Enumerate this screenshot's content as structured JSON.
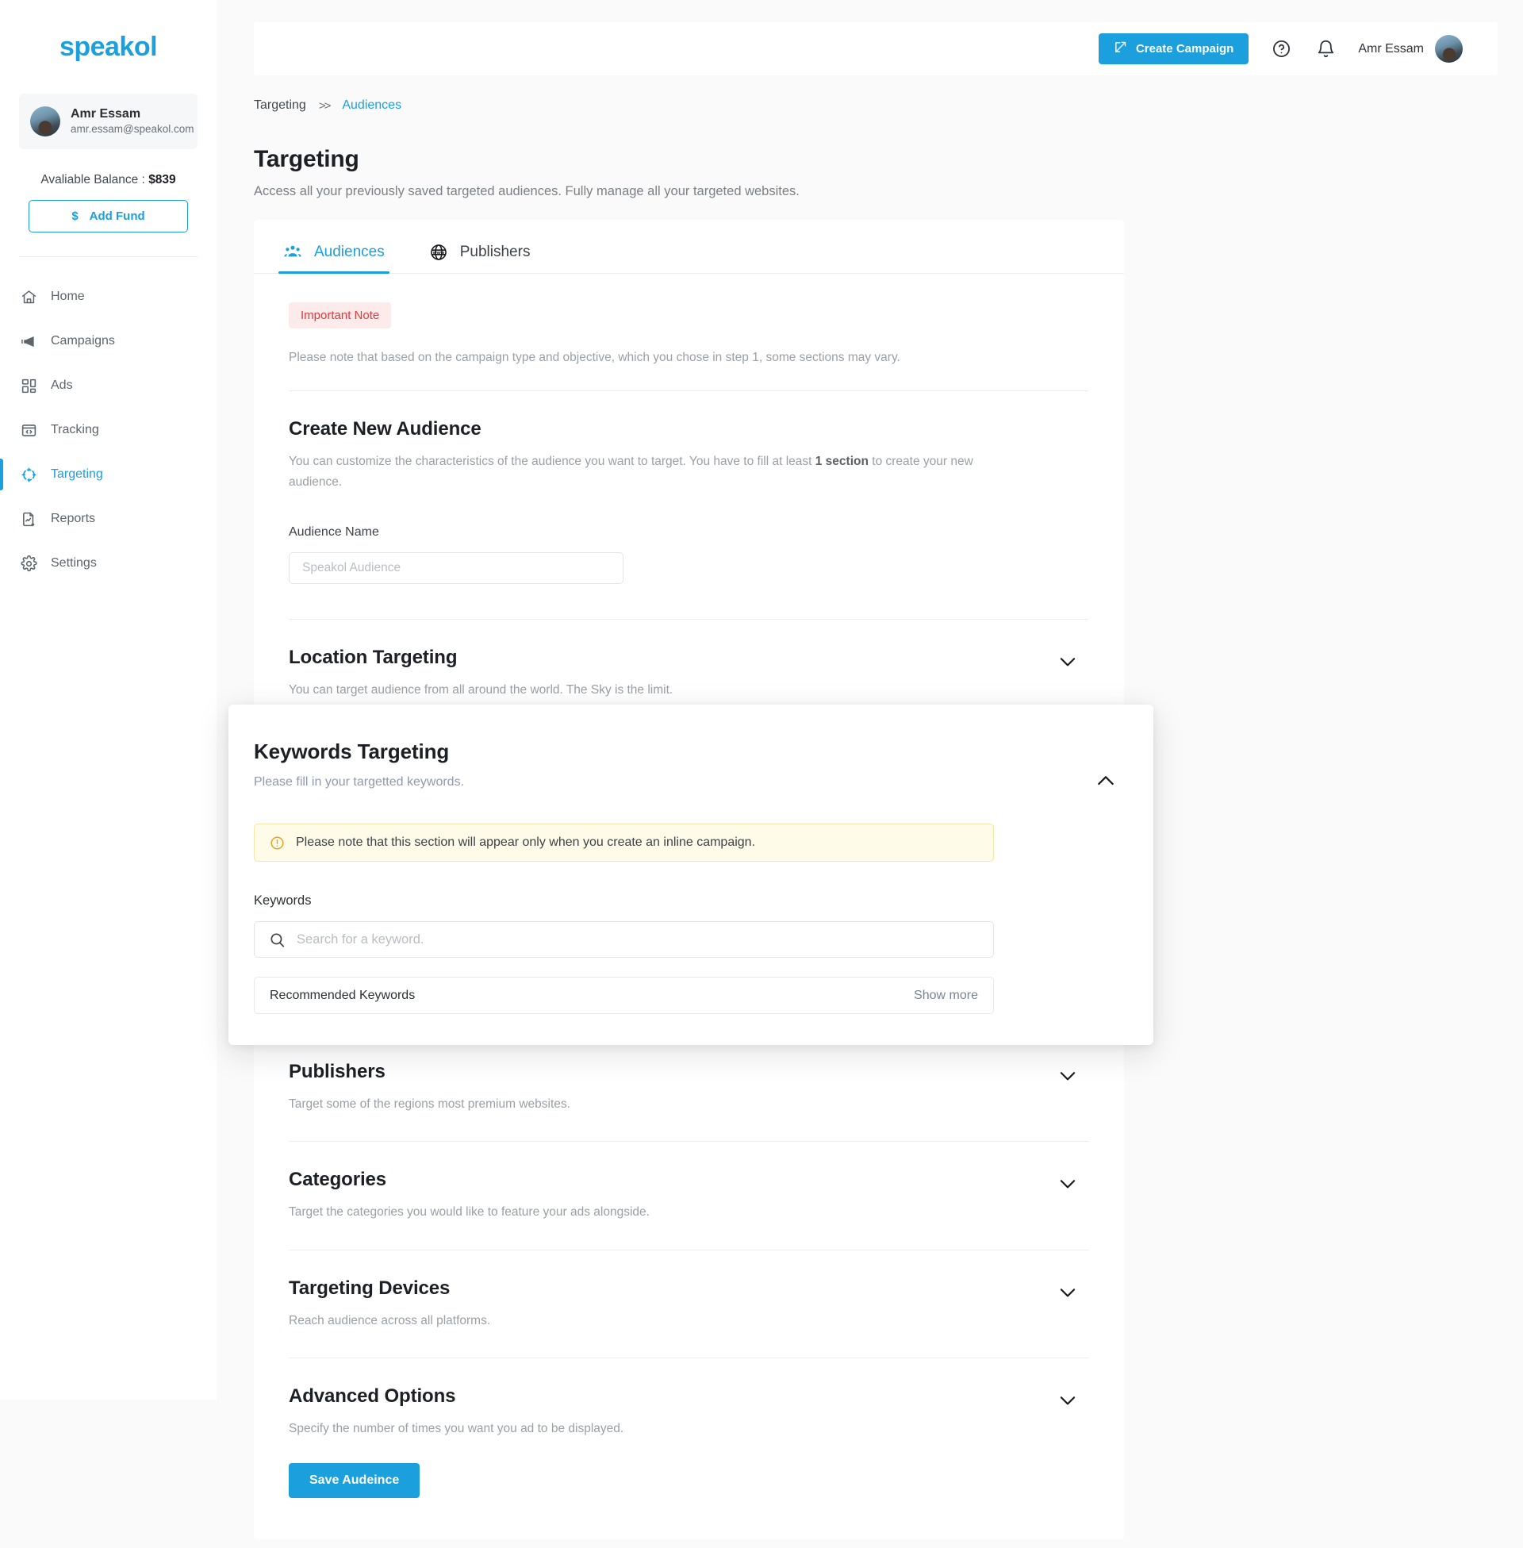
{
  "brand": {
    "name": "speakol"
  },
  "sidebar": {
    "user": {
      "name": "Amr Essam",
      "email": "amr.essam@speakol.com",
      "avatar_icon": "user-avatar"
    },
    "balance_label": "Avaliable Balance :",
    "balance_value": "$839",
    "add_fund_label": "Add Fund",
    "add_fund_currency": "$",
    "items": [
      {
        "label": "Home",
        "icon": "home-icon",
        "active": false
      },
      {
        "label": "Campaigns",
        "icon": "megaphone-icon",
        "active": false
      },
      {
        "label": "Ads",
        "icon": "grid-icon",
        "active": false
      },
      {
        "label": "Tracking",
        "icon": "code-window-icon",
        "active": false
      },
      {
        "label": "Targeting",
        "icon": "crosshair-icon",
        "active": true
      },
      {
        "label": "Reports",
        "icon": "report-download-icon",
        "active": false
      },
      {
        "label": "Settings",
        "icon": "gear-icon",
        "active": false
      }
    ]
  },
  "topbar": {
    "create_campaign_label": "Create Campaign",
    "help_icon": "question-circle-icon",
    "notifications_icon": "bell-icon",
    "user_name": "Amr Essam"
  },
  "breadcrumb": {
    "parent": "Targeting",
    "separator": ">>",
    "current": "Audiences"
  },
  "page": {
    "title": "Targeting",
    "subtitle": "Access all your previously saved targeted audiences. Fully manage all your targeted websites."
  },
  "tabs": [
    {
      "label": "Audiences",
      "icon": "people-group-icon",
      "active": true
    },
    {
      "label": "Publishers",
      "icon": "www-globe-icon",
      "active": false
    }
  ],
  "important_note": {
    "badge": "Important Note",
    "text": "Please note that based on the campaign type and objective, which you chose in step 1, some sections may vary."
  },
  "create_audience": {
    "title": "Create New Audience",
    "description_part1": "You can customize the characteristics of the audience you want to target. You have to fill at least ",
    "description_bold": "1 section",
    "description_part2": " to create your new audience.",
    "name_label": "Audience Name",
    "name_value": "",
    "name_placeholder": "Speakol Audience"
  },
  "sections": [
    {
      "title": "Location Targeting",
      "subtitle": "You can target audience from all around the world. The Sky is the limit.",
      "chevron": "chevron-down-icon",
      "expanded": false
    },
    {
      "title": "Publishers",
      "subtitle": "Target some of the regions most premium websites.",
      "chevron": "chevron-down-icon",
      "expanded": false
    },
    {
      "title": "Categories",
      "subtitle": "Target the categories you would like to feature your ads alongside.",
      "chevron": "chevron-down-icon",
      "expanded": false
    },
    {
      "title": "Targeting Devices",
      "subtitle": "Reach audience across all platforms.",
      "chevron": "chevron-down-icon",
      "expanded": false
    },
    {
      "title": "Advanced Options",
      "subtitle": "Specify the number of times you want you ad to be displayed.",
      "chevron": "chevron-down-icon",
      "expanded": false
    }
  ],
  "keywords_panel": {
    "title": "Keywords Targeting",
    "subtitle": "Please fill in your targetted keywords.",
    "chevron": "chevron-up-icon",
    "alert_icon": "exclamation-circle-icon",
    "alert_text": "Please note that this section will appear only when you create an inline campaign.",
    "keywords_label": "Keywords",
    "search_value": "",
    "search_placeholder": "Search for a keyword.",
    "search_icon": "search-icon",
    "recommended_label": "Recommended Keywords",
    "show_more_label": "Show more"
  },
  "save_button": {
    "label": "Save Audeince"
  },
  "colors": {
    "accent": "#1b9fdd",
    "danger": "#e6383c",
    "danger_bg": "#fdeaea",
    "warning_bg": "#fefbe8",
    "warning_border": "#f6e7a8",
    "page_bg": "#fafafa",
    "card_bg": "#ffffff",
    "muted_text": "#9aa0a6"
  }
}
